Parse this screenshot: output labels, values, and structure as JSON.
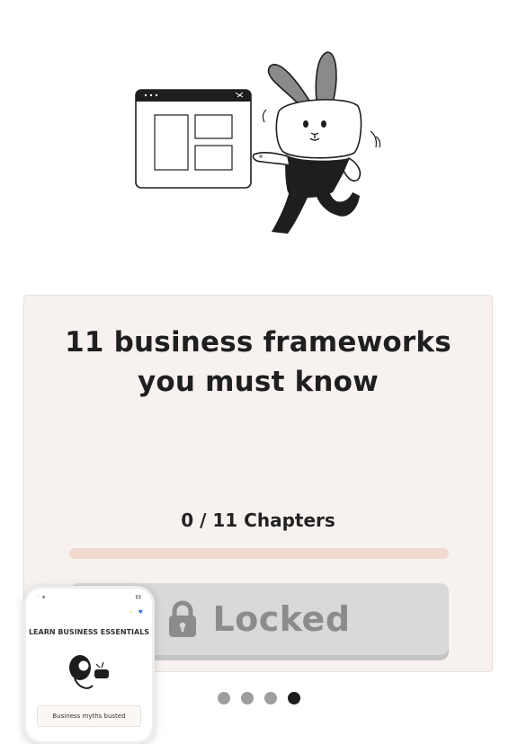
{
  "hero": {
    "illustration": "rabbit-presenting-browser-window"
  },
  "course_card": {
    "title_line1": "11 business frameworks",
    "title_line2": "you must know",
    "chapters_text": "0 / 11 Chapters",
    "progress_fraction": 0,
    "locked_label": "Locked",
    "lock_icon": "lock-icon"
  },
  "pagination": {
    "total": 4,
    "active_index": 3
  },
  "phone_preview": {
    "heading": "LEARN BUSINESS ESSENTIALS",
    "item_label": "Business myths busted"
  },
  "colors": {
    "card_bg": "#f7f2f0",
    "progress_track": "#f1d9cf",
    "locked_bg": "#d9d9d9",
    "locked_text": "#8c8c8c",
    "dot_inactive": "#9e9e9e",
    "dot_active": "#1c1c1c"
  }
}
